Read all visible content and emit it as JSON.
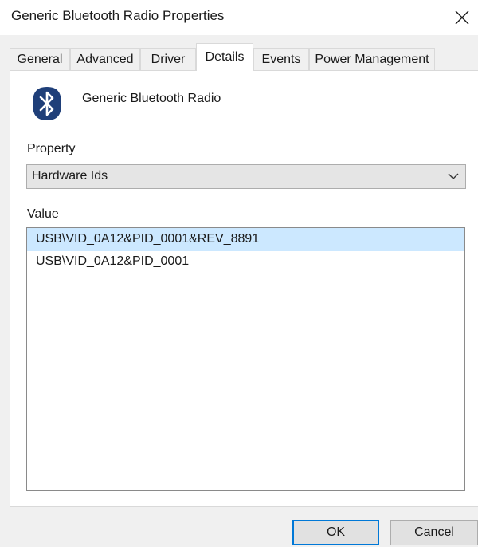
{
  "window": {
    "title": "Generic Bluetooth Radio Properties",
    "close_label": "×"
  },
  "tabs": [
    {
      "label": "General",
      "active": false
    },
    {
      "label": "Advanced",
      "active": false
    },
    {
      "label": "Driver",
      "active": false
    },
    {
      "label": "Details",
      "active": true
    },
    {
      "label": "Events",
      "active": false
    },
    {
      "label": "Power Management",
      "active": false
    }
  ],
  "device": {
    "name": "Generic Bluetooth Radio",
    "icon": "bluetooth-icon",
    "icon_color": "#1f3f79"
  },
  "property": {
    "label": "Property",
    "selected": "Hardware Ids"
  },
  "value": {
    "label": "Value",
    "items": [
      {
        "text": "USB\\VID_0A12&PID_0001&REV_8891",
        "selected": true
      },
      {
        "text": "USB\\VID_0A12&PID_0001",
        "selected": false
      }
    ]
  },
  "buttons": {
    "ok": "OK",
    "cancel": "Cancel"
  },
  "colors": {
    "selection": "#cce8ff",
    "accent": "#0078d7"
  }
}
